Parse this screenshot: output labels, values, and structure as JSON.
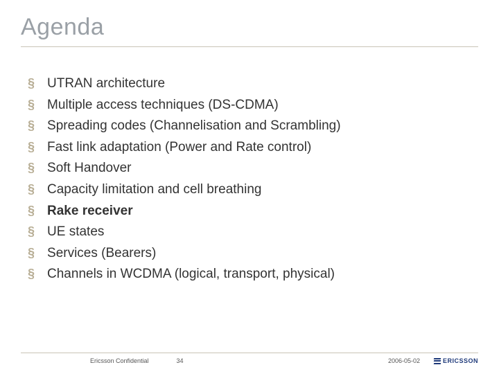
{
  "title": "Agenda",
  "items": [
    {
      "label": "UTRAN architecture",
      "bold": false
    },
    {
      "label": "Multiple access techniques (DS-CDMA)",
      "bold": false
    },
    {
      "label": "Spreading codes (Channelisation and Scrambling)",
      "bold": false
    },
    {
      "label": "Fast link adaptation (Power and Rate control)",
      "bold": false
    },
    {
      "label": "Soft Handover",
      "bold": false
    },
    {
      "label": "Capacity limitation and cell breathing",
      "bold": false
    },
    {
      "label": "Rake receiver",
      "bold": true
    },
    {
      "label": "UE states",
      "bold": false
    },
    {
      "label": "Services (Bearers)",
      "bold": false
    },
    {
      "label": "Channels in WCDMA (logical, transport, physical)",
      "bold": false
    }
  ],
  "footer": {
    "confidential": "Ericsson Confidential",
    "page": "34",
    "date": "2006-05-02",
    "brand": "ERICSSON"
  },
  "bullet_char": "§"
}
